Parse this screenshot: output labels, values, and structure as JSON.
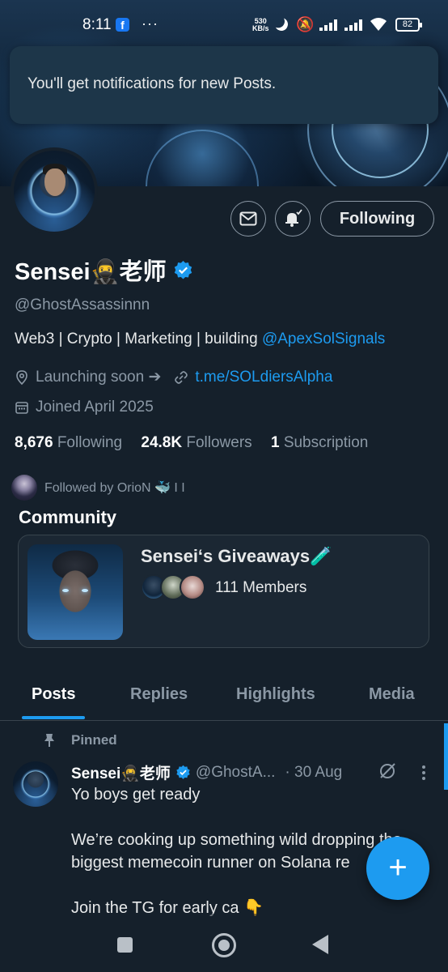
{
  "status_bar": {
    "time": "8:11",
    "net_speed": "530\nKB/s",
    "overflow": "···",
    "battery": "82"
  },
  "toast": {
    "message": "You'll get notifications for new Posts."
  },
  "profile": {
    "following_button": "Following",
    "display_name": "Sensei🥷老师",
    "handle": "@GhostAssassinnn",
    "bio_text": "Web3 | Crypto | Marketing | building ",
    "bio_link": "@ApexSolSignals",
    "location": "Launching soon ➔",
    "website": "t.me/SOLdiersAlpha",
    "joined": "Joined April 2025",
    "stats": {
      "following_count": "8,676",
      "following_label": "Following",
      "followers_count": "24.8K",
      "followers_label": "Followers",
      "subscription_count": "1",
      "subscription_label": "Subscription"
    },
    "followed_by": "Followed by OrioN 🐳 I I"
  },
  "community": {
    "section_title": "Community",
    "name": "Sensei‘s Giveaways🧪",
    "members": "111 Members"
  },
  "tabs": [
    "Posts",
    "Replies",
    "Highlights",
    "Media"
  ],
  "post": {
    "pinned_label": "Pinned",
    "author_name": "Sensei🥷老师",
    "author_handle": "@GhostA...",
    "date": "· 30 Aug",
    "lines": [
      "Yo boys get ready",
      "",
      "We’re cooking up something wild dropping the",
      "biggest memecoin runner on Solana re",
      "",
      "Join the TG for early ca 👇"
    ]
  },
  "fab_label": "+",
  "colors": {
    "background": "#15202b",
    "accent": "#1d9bf0",
    "secondary_text": "#8b98a5",
    "border": "#38444d"
  }
}
